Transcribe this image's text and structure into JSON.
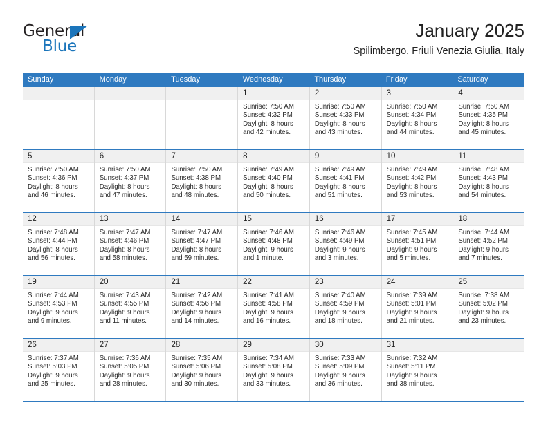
{
  "brand": {
    "name_top": "General",
    "name_bottom": "Blue",
    "logo_icon": "blue-triangle-icon",
    "color_black": "#231f20",
    "color_blue": "#1b75bb"
  },
  "header": {
    "title": "January 2025",
    "subtitle": "Spilimbergo, Friuli Venezia Giulia, Italy"
  },
  "theme": {
    "header_blue": "#2f7ac0",
    "day_band": "#f0f0f0",
    "cell_border": "#d8d8d8"
  },
  "weekdays": [
    "Sunday",
    "Monday",
    "Tuesday",
    "Wednesday",
    "Thursday",
    "Friday",
    "Saturday"
  ],
  "weeks": [
    [
      {
        "day": "",
        "empty": true
      },
      {
        "day": "",
        "empty": true
      },
      {
        "day": "",
        "empty": true
      },
      {
        "day": "1",
        "sunrise": "Sunrise: 7:50 AM",
        "sunset": "Sunset: 4:32 PM",
        "daylight1": "Daylight: 8 hours",
        "daylight2": "and 42 minutes."
      },
      {
        "day": "2",
        "sunrise": "Sunrise: 7:50 AM",
        "sunset": "Sunset: 4:33 PM",
        "daylight1": "Daylight: 8 hours",
        "daylight2": "and 43 minutes."
      },
      {
        "day": "3",
        "sunrise": "Sunrise: 7:50 AM",
        "sunset": "Sunset: 4:34 PM",
        "daylight1": "Daylight: 8 hours",
        "daylight2": "and 44 minutes."
      },
      {
        "day": "4",
        "sunrise": "Sunrise: 7:50 AM",
        "sunset": "Sunset: 4:35 PM",
        "daylight1": "Daylight: 8 hours",
        "daylight2": "and 45 minutes."
      }
    ],
    [
      {
        "day": "5",
        "sunrise": "Sunrise: 7:50 AM",
        "sunset": "Sunset: 4:36 PM",
        "daylight1": "Daylight: 8 hours",
        "daylight2": "and 46 minutes."
      },
      {
        "day": "6",
        "sunrise": "Sunrise: 7:50 AM",
        "sunset": "Sunset: 4:37 PM",
        "daylight1": "Daylight: 8 hours",
        "daylight2": "and 47 minutes."
      },
      {
        "day": "7",
        "sunrise": "Sunrise: 7:50 AM",
        "sunset": "Sunset: 4:38 PM",
        "daylight1": "Daylight: 8 hours",
        "daylight2": "and 48 minutes."
      },
      {
        "day": "8",
        "sunrise": "Sunrise: 7:49 AM",
        "sunset": "Sunset: 4:40 PM",
        "daylight1": "Daylight: 8 hours",
        "daylight2": "and 50 minutes."
      },
      {
        "day": "9",
        "sunrise": "Sunrise: 7:49 AM",
        "sunset": "Sunset: 4:41 PM",
        "daylight1": "Daylight: 8 hours",
        "daylight2": "and 51 minutes."
      },
      {
        "day": "10",
        "sunrise": "Sunrise: 7:49 AM",
        "sunset": "Sunset: 4:42 PM",
        "daylight1": "Daylight: 8 hours",
        "daylight2": "and 53 minutes."
      },
      {
        "day": "11",
        "sunrise": "Sunrise: 7:48 AM",
        "sunset": "Sunset: 4:43 PM",
        "daylight1": "Daylight: 8 hours",
        "daylight2": "and 54 minutes."
      }
    ],
    [
      {
        "day": "12",
        "sunrise": "Sunrise: 7:48 AM",
        "sunset": "Sunset: 4:44 PM",
        "daylight1": "Daylight: 8 hours",
        "daylight2": "and 56 minutes."
      },
      {
        "day": "13",
        "sunrise": "Sunrise: 7:47 AM",
        "sunset": "Sunset: 4:46 PM",
        "daylight1": "Daylight: 8 hours",
        "daylight2": "and 58 minutes."
      },
      {
        "day": "14",
        "sunrise": "Sunrise: 7:47 AM",
        "sunset": "Sunset: 4:47 PM",
        "daylight1": "Daylight: 8 hours",
        "daylight2": "and 59 minutes."
      },
      {
        "day": "15",
        "sunrise": "Sunrise: 7:46 AM",
        "sunset": "Sunset: 4:48 PM",
        "daylight1": "Daylight: 9 hours",
        "daylight2": "and 1 minute."
      },
      {
        "day": "16",
        "sunrise": "Sunrise: 7:46 AM",
        "sunset": "Sunset: 4:49 PM",
        "daylight1": "Daylight: 9 hours",
        "daylight2": "and 3 minutes."
      },
      {
        "day": "17",
        "sunrise": "Sunrise: 7:45 AM",
        "sunset": "Sunset: 4:51 PM",
        "daylight1": "Daylight: 9 hours",
        "daylight2": "and 5 minutes."
      },
      {
        "day": "18",
        "sunrise": "Sunrise: 7:44 AM",
        "sunset": "Sunset: 4:52 PM",
        "daylight1": "Daylight: 9 hours",
        "daylight2": "and 7 minutes."
      }
    ],
    [
      {
        "day": "19",
        "sunrise": "Sunrise: 7:44 AM",
        "sunset": "Sunset: 4:53 PM",
        "daylight1": "Daylight: 9 hours",
        "daylight2": "and 9 minutes."
      },
      {
        "day": "20",
        "sunrise": "Sunrise: 7:43 AM",
        "sunset": "Sunset: 4:55 PM",
        "daylight1": "Daylight: 9 hours",
        "daylight2": "and 11 minutes."
      },
      {
        "day": "21",
        "sunrise": "Sunrise: 7:42 AM",
        "sunset": "Sunset: 4:56 PM",
        "daylight1": "Daylight: 9 hours",
        "daylight2": "and 14 minutes."
      },
      {
        "day": "22",
        "sunrise": "Sunrise: 7:41 AM",
        "sunset": "Sunset: 4:58 PM",
        "daylight1": "Daylight: 9 hours",
        "daylight2": "and 16 minutes."
      },
      {
        "day": "23",
        "sunrise": "Sunrise: 7:40 AM",
        "sunset": "Sunset: 4:59 PM",
        "daylight1": "Daylight: 9 hours",
        "daylight2": "and 18 minutes."
      },
      {
        "day": "24",
        "sunrise": "Sunrise: 7:39 AM",
        "sunset": "Sunset: 5:01 PM",
        "daylight1": "Daylight: 9 hours",
        "daylight2": "and 21 minutes."
      },
      {
        "day": "25",
        "sunrise": "Sunrise: 7:38 AM",
        "sunset": "Sunset: 5:02 PM",
        "daylight1": "Daylight: 9 hours",
        "daylight2": "and 23 minutes."
      }
    ],
    [
      {
        "day": "26",
        "sunrise": "Sunrise: 7:37 AM",
        "sunset": "Sunset: 5:03 PM",
        "daylight1": "Daylight: 9 hours",
        "daylight2": "and 25 minutes."
      },
      {
        "day": "27",
        "sunrise": "Sunrise: 7:36 AM",
        "sunset": "Sunset: 5:05 PM",
        "daylight1": "Daylight: 9 hours",
        "daylight2": "and 28 minutes."
      },
      {
        "day": "28",
        "sunrise": "Sunrise: 7:35 AM",
        "sunset": "Sunset: 5:06 PM",
        "daylight1": "Daylight: 9 hours",
        "daylight2": "and 30 minutes."
      },
      {
        "day": "29",
        "sunrise": "Sunrise: 7:34 AM",
        "sunset": "Sunset: 5:08 PM",
        "daylight1": "Daylight: 9 hours",
        "daylight2": "and 33 minutes."
      },
      {
        "day": "30",
        "sunrise": "Sunrise: 7:33 AM",
        "sunset": "Sunset: 5:09 PM",
        "daylight1": "Daylight: 9 hours",
        "daylight2": "and 36 minutes."
      },
      {
        "day": "31",
        "sunrise": "Sunrise: 7:32 AM",
        "sunset": "Sunset: 5:11 PM",
        "daylight1": "Daylight: 9 hours",
        "daylight2": "and 38 minutes."
      },
      {
        "day": "",
        "empty": true
      }
    ]
  ]
}
